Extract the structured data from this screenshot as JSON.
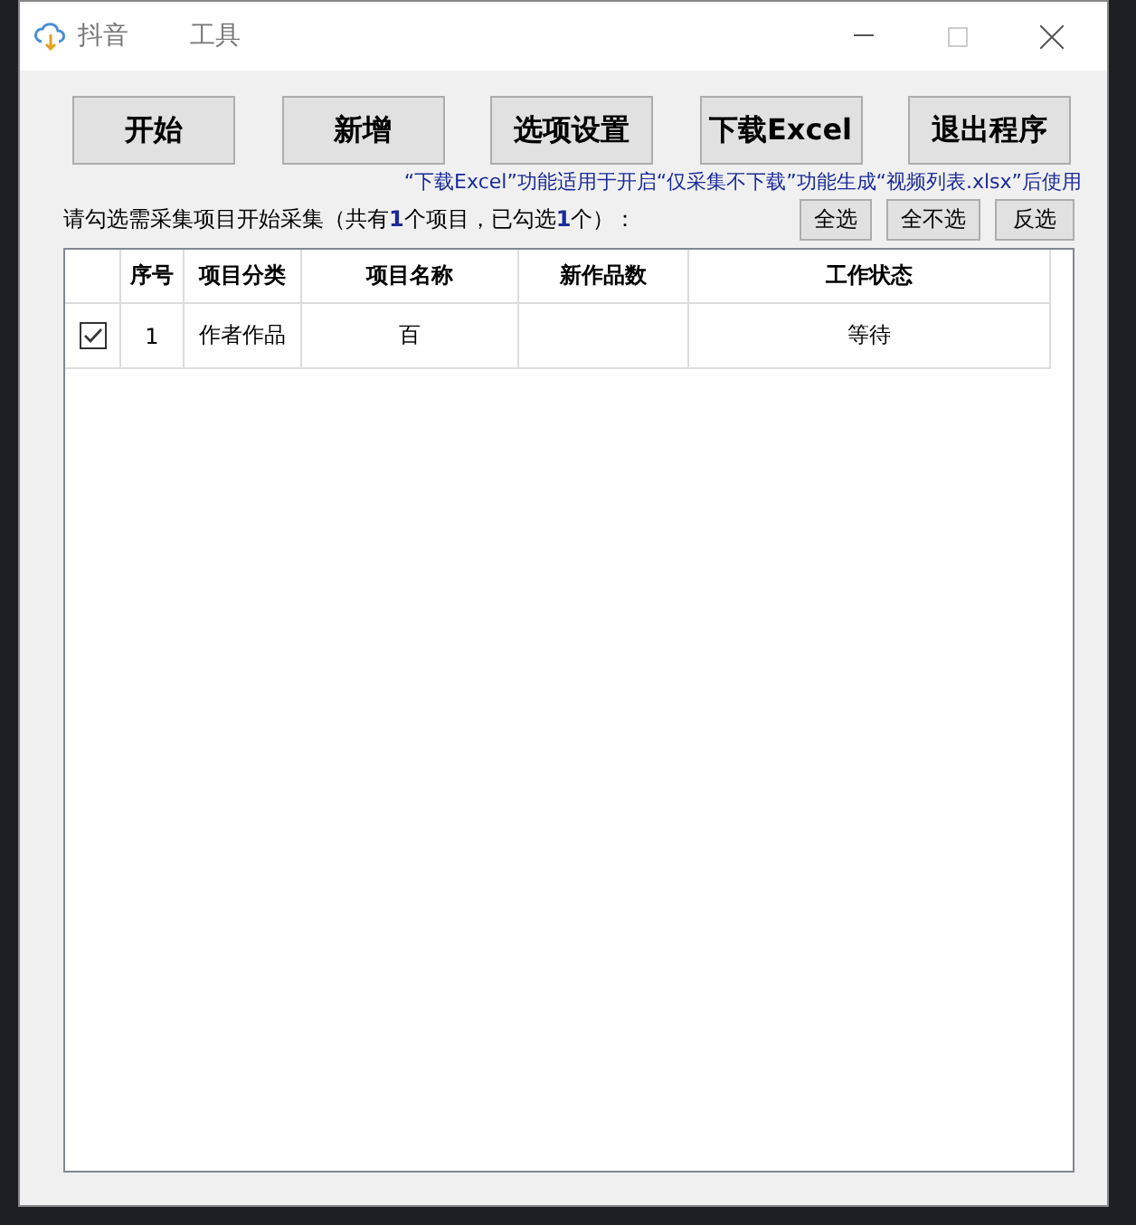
{
  "window": {
    "title_parts": [
      "抖音",
      "工具"
    ]
  },
  "toolbar": [
    "开始",
    "新增",
    "选项设置",
    "下载Excel",
    "退出程序"
  ],
  "note": "“下载Excel”功能适用于开启“仅采集不下载”功能生成“视频列表.xlsx”后使用",
  "prompt": "请勾选需采集项目开始采集（共有**1**个项目，已勾选**1**个）：",
  "select_buttons": [
    "全选",
    "全不选",
    "反选"
  ],
  "table": {
    "columns": [
      "序号",
      "项目分类",
      "项目名称",
      "新作品数",
      "工作状态"
    ],
    "rows": [
      {
        "checked": true,
        "cells": [
          "1",
          "作者作品",
          "百",
          "",
          "等待"
        ]
      }
    ]
  }
}
